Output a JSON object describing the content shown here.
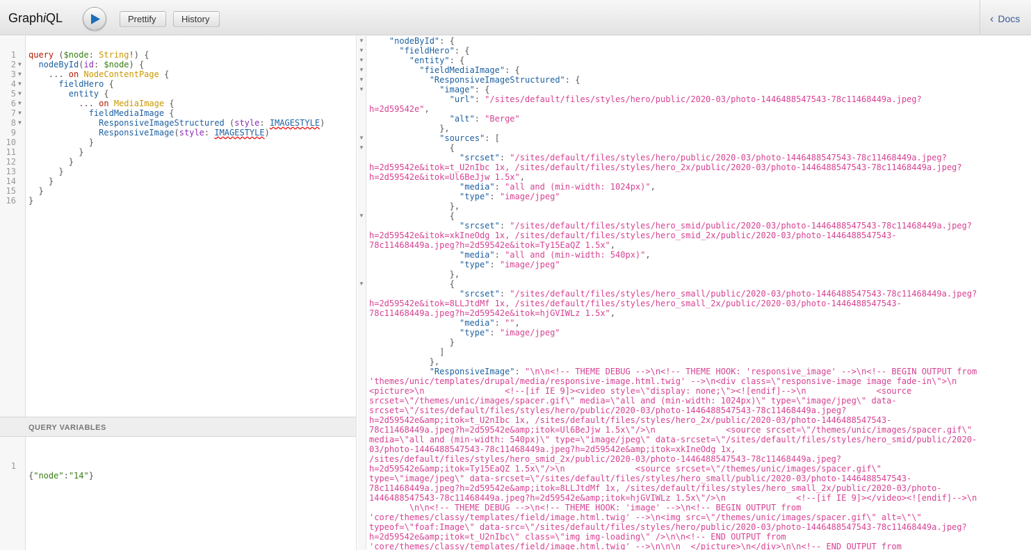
{
  "app": {
    "title_prefix": "Graph",
    "title_italic": "i",
    "title_suffix": "QL"
  },
  "toolbar": {
    "run_icon": "play-icon",
    "prettify_label": "Prettify",
    "history_label": "History"
  },
  "docs": {
    "label": "Docs",
    "icon": "chevron-left-icon"
  },
  "query_lines": [
    [
      [
        "kw",
        "query"
      ],
      [
        "p",
        " ("
      ],
      [
        "var",
        "$node"
      ],
      [
        "p",
        ": "
      ],
      [
        "type",
        "String"
      ],
      [
        "p",
        "!) {"
      ]
    ],
    [
      [
        "p",
        "  "
      ],
      [
        "prop",
        "nodeById"
      ],
      [
        "p",
        "("
      ],
      [
        "attr",
        "id"
      ],
      [
        "p",
        ": "
      ],
      [
        "var",
        "$node"
      ],
      [
        "p",
        ") {"
      ]
    ],
    [
      [
        "p",
        "    ... "
      ],
      [
        "kw",
        "on"
      ],
      [
        "p",
        " "
      ],
      [
        "type",
        "NodeContentPage"
      ],
      [
        "p",
        " {"
      ]
    ],
    [
      [
        "p",
        "      "
      ],
      [
        "prop",
        "fieldHero"
      ],
      [
        "p",
        " {"
      ]
    ],
    [
      [
        "p",
        "        "
      ],
      [
        "prop",
        "entity"
      ],
      [
        "p",
        " {"
      ]
    ],
    [
      [
        "p",
        "          ... "
      ],
      [
        "kw",
        "on"
      ],
      [
        "p",
        " "
      ],
      [
        "type",
        "MediaImage"
      ],
      [
        "p",
        " {"
      ]
    ],
    [
      [
        "p",
        "            "
      ],
      [
        "prop",
        "fieldMediaImage"
      ],
      [
        "p",
        " {"
      ]
    ],
    [
      [
        "p",
        "              "
      ],
      [
        "prop",
        "ResponsiveImageStructured"
      ],
      [
        "p",
        " ("
      ],
      [
        "attr",
        "style"
      ],
      [
        "p",
        ": "
      ],
      [
        "err",
        "IMAGESTYLE"
      ],
      [
        "p",
        ")"
      ]
    ],
    [
      [
        "p",
        "              "
      ],
      [
        "prop",
        "ResponsiveImage"
      ],
      [
        "p",
        "("
      ],
      [
        "attr",
        "style"
      ],
      [
        "p",
        ": "
      ],
      [
        "err",
        "IMAGESTYLE"
      ],
      [
        "p",
        ")"
      ]
    ],
    [
      [
        "p",
        "            }"
      ]
    ],
    [
      [
        "p",
        "          }"
      ]
    ],
    [
      [
        "p",
        "        }"
      ]
    ],
    [
      [
        "p",
        "      }"
      ]
    ],
    [
      [
        "p",
        "    }"
      ]
    ],
    [
      [
        "p",
        "  }"
      ]
    ],
    [
      [
        "p",
        "}"
      ]
    ]
  ],
  "query_fold_lines": [
    1,
    2,
    3,
    4,
    5,
    6,
    7
  ],
  "variables": {
    "header": "QUERY VARIABLES",
    "line_number": "1",
    "text_parts": [
      [
        "p",
        "{"
      ],
      [
        "s",
        "\"node\""
      ],
      [
        "p",
        ":"
      ],
      [
        "s",
        "\"14\""
      ],
      [
        "p",
        "}"
      ]
    ]
  },
  "result_lines": [
    [
      [
        "p",
        "    "
      ],
      [
        "k",
        "\"nodeById\""
      ],
      [
        "p",
        ": {"
      ]
    ],
    [
      [
        "p",
        "      "
      ],
      [
        "k",
        "\"fieldHero\""
      ],
      [
        "p",
        ": {"
      ]
    ],
    [
      [
        "p",
        "        "
      ],
      [
        "k",
        "\"entity\""
      ],
      [
        "p",
        ": {"
      ]
    ],
    [
      [
        "p",
        "          "
      ],
      [
        "k",
        "\"fieldMediaImage\""
      ],
      [
        "p",
        ": {"
      ]
    ],
    [
      [
        "p",
        "            "
      ],
      [
        "k",
        "\"ResponsiveImageStructured\""
      ],
      [
        "p",
        ": {"
      ]
    ],
    [
      [
        "p",
        "              "
      ],
      [
        "k",
        "\"image\""
      ],
      [
        "p",
        ": {"
      ]
    ],
    [
      [
        "p",
        "                "
      ],
      [
        "k",
        "\"url\""
      ],
      [
        "p",
        ": "
      ],
      [
        "s",
        "\"/sites/default/files/styles/hero/public/2020-03/photo-1446488547543-78c11468449a.jpeg?"
      ]
    ],
    [
      [
        "s",
        "h=2d59542e\""
      ],
      [
        "p",
        ","
      ]
    ],
    [
      [
        "p",
        "                "
      ],
      [
        "k",
        "\"alt\""
      ],
      [
        "p",
        ": "
      ],
      [
        "s",
        "\"Berge\""
      ]
    ],
    [
      [
        "p",
        "              },"
      ]
    ],
    [
      [
        "p",
        "              "
      ],
      [
        "k",
        "\"sources\""
      ],
      [
        "p",
        ": ["
      ]
    ],
    [
      [
        "p",
        "                {"
      ]
    ],
    [
      [
        "p",
        "                  "
      ],
      [
        "k",
        "\"srcset\""
      ],
      [
        "p",
        ": "
      ],
      [
        "s",
        "\"/sites/default/files/styles/hero/public/2020-03/photo-1446488547543-78c11468449a.jpeg?"
      ]
    ],
    [
      [
        "s",
        "h=2d59542e&itok=t_U2nIbc 1x, /sites/default/files/styles/hero_2x/public/2020-03/photo-1446488547543-78c11468449a.jpeg?"
      ]
    ],
    [
      [
        "s",
        "h=2d59542e&itok=Ul6BeJjw 1.5x\""
      ],
      [
        "p",
        ","
      ]
    ],
    [
      [
        "p",
        "                  "
      ],
      [
        "k",
        "\"media\""
      ],
      [
        "p",
        ": "
      ],
      [
        "s",
        "\"all and (min-width: 1024px)\""
      ],
      [
        "p",
        ","
      ]
    ],
    [
      [
        "p",
        "                  "
      ],
      [
        "k",
        "\"type\""
      ],
      [
        "p",
        ": "
      ],
      [
        "s",
        "\"image/jpeg\""
      ]
    ],
    [
      [
        "p",
        "                },"
      ]
    ],
    [
      [
        "p",
        "                {"
      ]
    ],
    [
      [
        "p",
        "                  "
      ],
      [
        "k",
        "\"srcset\""
      ],
      [
        "p",
        ": "
      ],
      [
        "s",
        "\"/sites/default/files/styles/hero_smid/public/2020-03/photo-1446488547543-78c11468449a.jpeg?"
      ]
    ],
    [
      [
        "s",
        "h=2d59542e&itok=xkIneOdg 1x, /sites/default/files/styles/hero_smid_2x/public/2020-03/photo-1446488547543-"
      ]
    ],
    [
      [
        "s",
        "78c11468449a.jpeg?h=2d59542e&itok=Ty15EaQZ 1.5x\""
      ],
      [
        "p",
        ","
      ]
    ],
    [
      [
        "p",
        "                  "
      ],
      [
        "k",
        "\"media\""
      ],
      [
        "p",
        ": "
      ],
      [
        "s",
        "\"all and (min-width: 540px)\""
      ],
      [
        "p",
        ","
      ]
    ],
    [
      [
        "p",
        "                  "
      ],
      [
        "k",
        "\"type\""
      ],
      [
        "p",
        ": "
      ],
      [
        "s",
        "\"image/jpeg\""
      ]
    ],
    [
      [
        "p",
        "                },"
      ]
    ],
    [
      [
        "p",
        "                {"
      ]
    ],
    [
      [
        "p",
        "                  "
      ],
      [
        "k",
        "\"srcset\""
      ],
      [
        "p",
        ": "
      ],
      [
        "s",
        "\"/sites/default/files/styles/hero_small/public/2020-03/photo-1446488547543-78c11468449a.jpeg?"
      ]
    ],
    [
      [
        "s",
        "h=2d59542e&itok=8LLJtdMf 1x, /sites/default/files/styles/hero_small_2x/public/2020-03/photo-1446488547543-"
      ]
    ],
    [
      [
        "s",
        "78c11468449a.jpeg?h=2d59542e&itok=hjGVIWLz 1.5x\""
      ],
      [
        "p",
        ","
      ]
    ],
    [
      [
        "p",
        "                  "
      ],
      [
        "k",
        "\"media\""
      ],
      [
        "p",
        ": "
      ],
      [
        "s",
        "\"\""
      ],
      [
        "p",
        ","
      ]
    ],
    [
      [
        "p",
        "                  "
      ],
      [
        "k",
        "\"type\""
      ],
      [
        "p",
        ": "
      ],
      [
        "s",
        "\"image/jpeg\""
      ]
    ],
    [
      [
        "p",
        "                }"
      ]
    ],
    [
      [
        "p",
        "              ]"
      ]
    ],
    [
      [
        "p",
        "            },"
      ]
    ],
    [
      [
        "p",
        "            "
      ],
      [
        "k",
        "\"ResponsiveImage\""
      ],
      [
        "p",
        ": "
      ],
      [
        "s",
        "\"\\n\\n<!-- THEME DEBUG -->\\n<!-- THEME HOOK: 'responsive_image' -->\\n<!-- BEGIN OUTPUT from"
      ]
    ],
    [
      [
        "s",
        "'themes/unic/templates/drupal/media/responsive-image.html.twig' -->\\n<div class=\\\"responsive-image image fade-in\\\">\\n"
      ]
    ],
    [
      [
        "s",
        "<picture>\\n                <!--[if IE 9]><video style=\\\"display: none;\\\"><![endif]-->\\n              <source"
      ]
    ],
    [
      [
        "s",
        "srcset=\\\"/themes/unic/images/spacer.gif\\\" media=\\\"all and (min-width: 1024px)\\\" type=\\\"image/jpeg\\\" data-"
      ]
    ],
    [
      [
        "s",
        "srcset=\\\"/sites/default/files/styles/hero/public/2020-03/photo-1446488547543-78c11468449a.jpeg?"
      ]
    ],
    [
      [
        "s",
        "h=2d59542e&amp;itok=t_U2nIbc 1x, /sites/default/files/styles/hero_2x/public/2020-03/photo-1446488547543-"
      ]
    ],
    [
      [
        "s",
        "78c11468449a.jpeg?h=2d59542e&amp;itok=Ul6BeJjw 1.5x\\\"/>\\n              <source srcset=\\\"/themes/unic/images/spacer.gif\\\""
      ]
    ],
    [
      [
        "s",
        "media=\\\"all and (min-width: 540px)\\\" type=\\\"image/jpeg\\\" data-srcset=\\\"/sites/default/files/styles/hero_smid/public/2020-"
      ]
    ],
    [
      [
        "s",
        "03/photo-1446488547543-78c11468449a.jpeg?h=2d59542e&amp;itok=xkIneOdg 1x,"
      ]
    ],
    [
      [
        "s",
        "/sites/default/files/styles/hero_smid_2x/public/2020-03/photo-1446488547543-78c11468449a.jpeg?"
      ]
    ],
    [
      [
        "s",
        "h=2d59542e&amp;itok=Ty15EaQZ 1.5x\\\"/>\\n              <source srcset=\\\"/themes/unic/images/spacer.gif\\\""
      ]
    ],
    [
      [
        "s",
        "type=\\\"image/jpeg\\\" data-srcset=\\\"/sites/default/files/styles/hero_small/public/2020-03/photo-1446488547543-"
      ]
    ],
    [
      [
        "s",
        "78c11468449a.jpeg?h=2d59542e&amp;itok=8LLJtdMf 1x, /sites/default/files/styles/hero_small_2x/public/2020-03/photo-"
      ]
    ],
    [
      [
        "s",
        "1446488547543-78c11468449a.jpeg?h=2d59542e&amp;itok=hjGVIWLz 1.5x\\\"/>\\n              <!--[if IE 9]></video><![endif]-->\\n"
      ]
    ],
    [
      [
        "s",
        "        \\n\\n<!-- THEME DEBUG -->\\n<!-- THEME HOOK: 'image' -->\\n<!-- BEGIN OUTPUT from"
      ]
    ],
    [
      [
        "s",
        "'core/themes/classy/templates/field/image.html.twig' -->\\n<img src=\\\"/themes/unic/images/spacer.gif\\\" alt=\\\"\\\""
      ]
    ],
    [
      [
        "s",
        "typeof=\\\"foaf:Image\\\" data-src=\\\"/sites/default/files/styles/hero/public/2020-03/photo-1446488547543-78c11468449a.jpeg?"
      ]
    ],
    [
      [
        "s",
        "h=2d59542e&amp;itok=t_U2nIbc\\\" class=\\\"img img-loading\\\" />\\n\\n<!-- END OUTPUT from"
      ]
    ],
    [
      [
        "s",
        "'core/themes/classy/templates/field/image.html.twig' -->\\n\\n\\n  </picture>\\n</div>\\n\\n<!-- END OUTPUT from"
      ]
    ]
  ],
  "result_fold_lines": [
    0,
    1,
    2,
    3,
    4,
    5,
    10,
    11,
    18,
    25
  ]
}
